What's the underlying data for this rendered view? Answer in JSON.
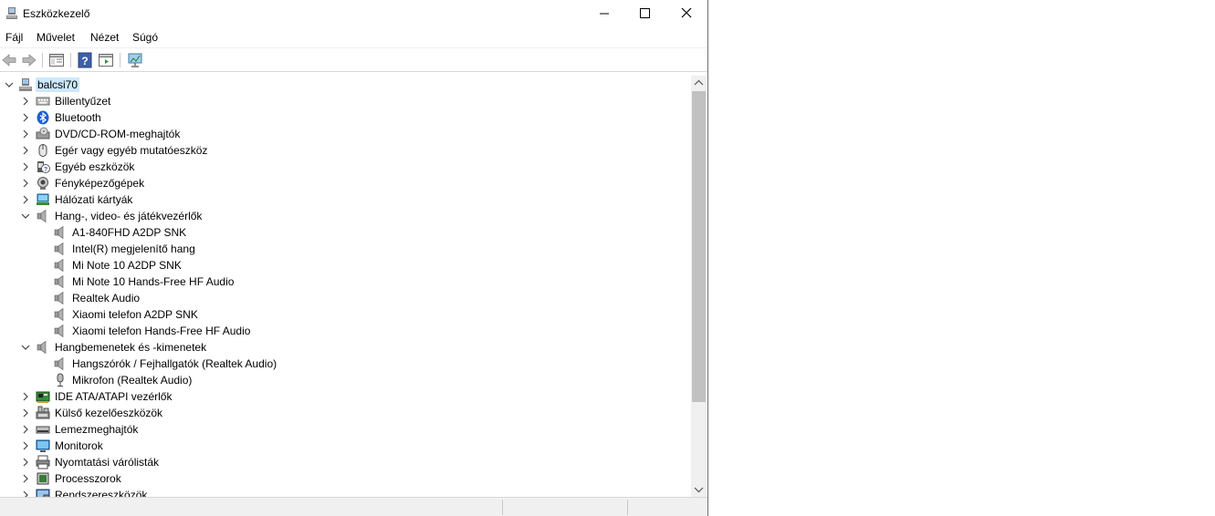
{
  "window": {
    "title": "Eszközkezelő"
  },
  "menu": [
    "Fájl",
    "Művelet",
    "Nézet",
    "Súgó"
  ],
  "toolbar": [
    "back-icon",
    "forward-icon",
    "properties-icon",
    "help-icon",
    "show-hide-icon",
    "scan-monitor-icon"
  ],
  "tree": {
    "root": "balcsi70",
    "items": [
      {
        "label": "Billentyűzet",
        "icon": "keyboard-icon",
        "state": "collapsed"
      },
      {
        "label": "Bluetooth",
        "icon": "bluetooth-icon",
        "state": "collapsed"
      },
      {
        "label": "DVD/CD-ROM-meghajtók",
        "icon": "dvd-icon",
        "state": "collapsed"
      },
      {
        "label": "Egér vagy egyéb mutatóeszköz",
        "icon": "mouse-icon",
        "state": "collapsed"
      },
      {
        "label": "Egyéb eszközök",
        "icon": "unknown-device-icon",
        "state": "collapsed"
      },
      {
        "label": "Fényképezőgépek",
        "icon": "camera-icon",
        "state": "collapsed"
      },
      {
        "label": "Hálózati kártyák",
        "icon": "network-icon",
        "state": "collapsed"
      },
      {
        "label": "Hang-, video- és játékvezérlők",
        "icon": "speaker-icon",
        "state": "expanded"
      },
      {
        "label": "A1-840FHD A2DP SNK",
        "icon": "speaker-icon",
        "state": "child"
      },
      {
        "label": "Intel(R) megjelenítő hang",
        "icon": "speaker-icon",
        "state": "child"
      },
      {
        "label": "Mi Note 10 A2DP SNK",
        "icon": "speaker-icon",
        "state": "child"
      },
      {
        "label": "Mi Note 10 Hands-Free HF Audio",
        "icon": "speaker-icon",
        "state": "child"
      },
      {
        "label": "Realtek Audio",
        "icon": "speaker-icon",
        "state": "child"
      },
      {
        "label": "Xiaomi telefon A2DP SNK",
        "icon": "speaker-icon",
        "state": "child"
      },
      {
        "label": "Xiaomi telefon Hands-Free HF Audio",
        "icon": "speaker-icon",
        "state": "child"
      },
      {
        "label": "Hangbemenetek és -kimenetek",
        "icon": "speaker-icon",
        "state": "expanded"
      },
      {
        "label": "Hangszórók / Fejhallgatók (Realtek Audio)",
        "icon": "speaker-icon",
        "state": "child"
      },
      {
        "label": "Mikrofon (Realtek Audio)",
        "icon": "microphone-icon",
        "state": "child"
      },
      {
        "label": "IDE ATA/ATAPI vezérlők",
        "icon": "ide-controller-icon",
        "state": "collapsed"
      },
      {
        "label": "Külső kezelőeszközök",
        "icon": "hid-icon",
        "state": "collapsed"
      },
      {
        "label": "Lemezmeghajtók",
        "icon": "disk-drive-icon",
        "state": "collapsed"
      },
      {
        "label": "Monitorok",
        "icon": "monitor-icon",
        "state": "collapsed"
      },
      {
        "label": "Nyomtatási várólisták",
        "icon": "printer-icon",
        "state": "collapsed"
      },
      {
        "label": "Processzorok",
        "icon": "processor-icon",
        "state": "collapsed"
      },
      {
        "label": "Rendszereszközök",
        "icon": "system-devices-icon",
        "state": "collapsed"
      }
    ]
  },
  "colors": {
    "selection": "#cce8ff",
    "accent": "#0078d7"
  }
}
